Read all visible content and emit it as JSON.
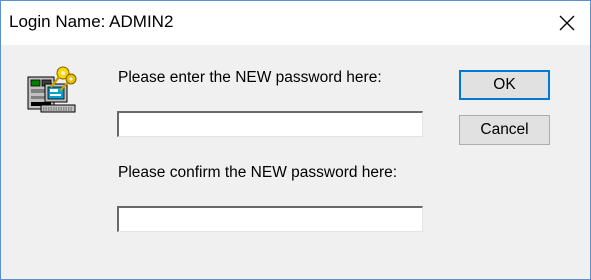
{
  "window": {
    "title": "Login Name: ADMIN2",
    "close_icon": "close-icon"
  },
  "dialog": {
    "icon": "computer-keys-icon",
    "new_password_label": "Please enter the NEW password here:",
    "new_password_value": "",
    "confirm_password_label": "Please confirm the NEW password here:",
    "confirm_password_value": ""
  },
  "buttons": {
    "ok_label": "OK",
    "cancel_label": "Cancel"
  },
  "colors": {
    "accent": "#0078d7",
    "window_border": "#5a8fd0",
    "client_bg": "#f0f0f0"
  }
}
